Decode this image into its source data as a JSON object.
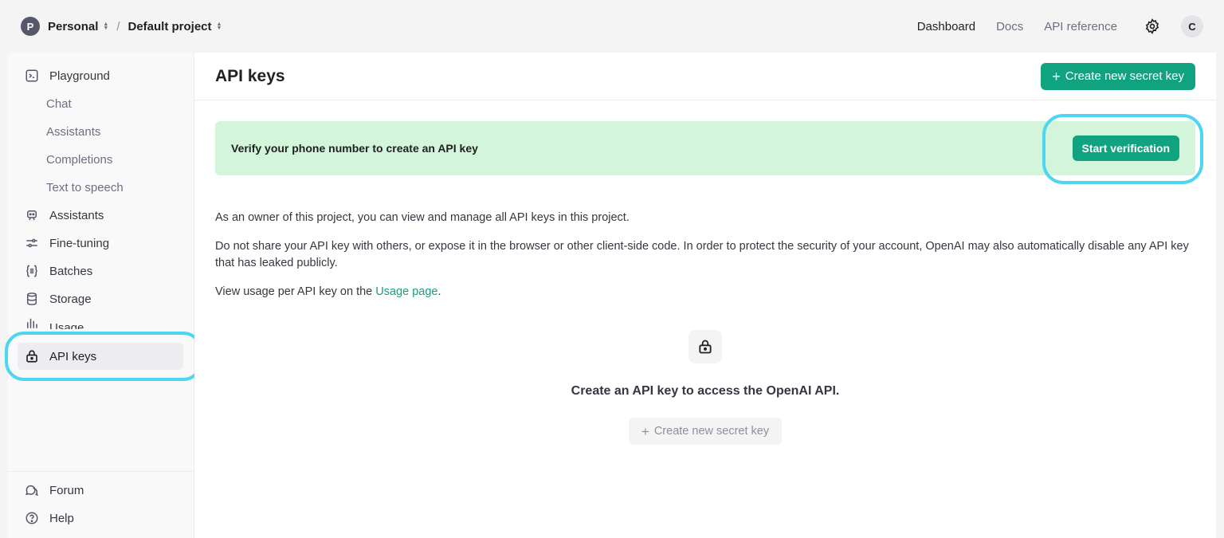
{
  "topbar": {
    "org_initial": "P",
    "org_name": "Personal",
    "separator": "/",
    "project_name": "Default project",
    "nav": [
      "Dashboard",
      "Docs",
      "API reference"
    ],
    "user_initial": "C"
  },
  "sidebar": {
    "items": [
      {
        "label": "Playground",
        "icon": "terminal-icon"
      },
      {
        "label": "Chat"
      },
      {
        "label": "Assistants"
      },
      {
        "label": "Completions"
      },
      {
        "label": "Text to speech"
      },
      {
        "label": "Assistants",
        "icon": "robot-icon"
      },
      {
        "label": "Fine-tuning",
        "icon": "sliders-icon"
      },
      {
        "label": "Batches",
        "icon": "braces-icon"
      },
      {
        "label": "Storage",
        "icon": "database-icon"
      },
      {
        "label": "Usage",
        "icon": "chart-icon"
      },
      {
        "label": "API keys",
        "icon": "lock-icon"
      }
    ],
    "footer": [
      {
        "label": "Forum",
        "icon": "chat-bubbles-icon"
      },
      {
        "label": "Help",
        "icon": "help-circle-icon"
      }
    ]
  },
  "main": {
    "title": "API keys",
    "create_button": "Create new secret key",
    "banner": {
      "text": "Verify your phone number to create an API key",
      "button": "Start verification"
    },
    "para1": "As an owner of this project, you can view and manage all API keys in this project.",
    "para2": "Do not share your API key with others, or expose it in the browser or other client-side code. In order to protect the security of your account, OpenAI may also automatically disable any API key that has leaked publicly.",
    "para3_prefix": "View usage per API key on the ",
    "para3_link": "Usage page",
    "para3_suffix": ".",
    "empty_title": "Create an API key to access the OpenAI API.",
    "empty_button": "Create new secret key"
  },
  "colors": {
    "accent": "#10a37f",
    "banner_bg": "#d3f5d9",
    "highlight": "#4dd6f2"
  }
}
